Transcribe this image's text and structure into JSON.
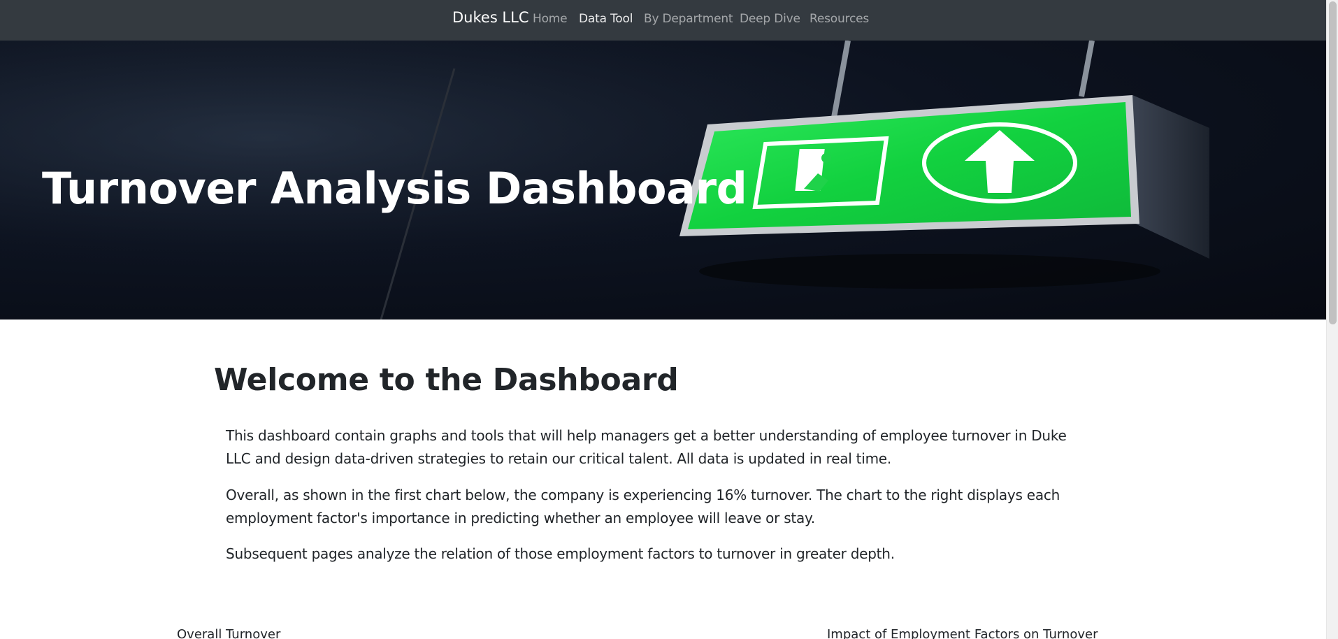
{
  "navbar": {
    "brand": "Dukes LLC",
    "links": [
      {
        "label": "Home",
        "active": false
      },
      {
        "label": "Data Tool",
        "active": true
      },
      {
        "label": "By Department",
        "active": false
      },
      {
        "label": "Deep Dive",
        "active": false
      },
      {
        "label": "Resources",
        "active": false
      }
    ]
  },
  "hero": {
    "title": "Turnover Analysis Dashboard",
    "image": "exit-sign-icon"
  },
  "main": {
    "heading": "Welcome to the Dashboard",
    "paragraphs": [
      "This dashboard contain graphs and tools that will help managers get a better understanding of employee turnover in Duke LLC and design data-driven strategies to retain our critical talent. All data is updated in real time.",
      "Overall, as shown in the first chart below, the company is experiencing 16% turnover. The chart to the right displays each employment factor's importance in predicting whether an employee will leave or stay.",
      "Subsequent pages analyze the relation of those employment factors to turnover in greater depth."
    ],
    "charts": [
      {
        "title": "Overall Turnover"
      },
      {
        "title": "Impact of Employment Factors on Turnover"
      }
    ]
  },
  "colors": {
    "navbar_bg": "#343a40",
    "sign_green": "#1fd24a",
    "hero_bg": "#0d1320"
  }
}
